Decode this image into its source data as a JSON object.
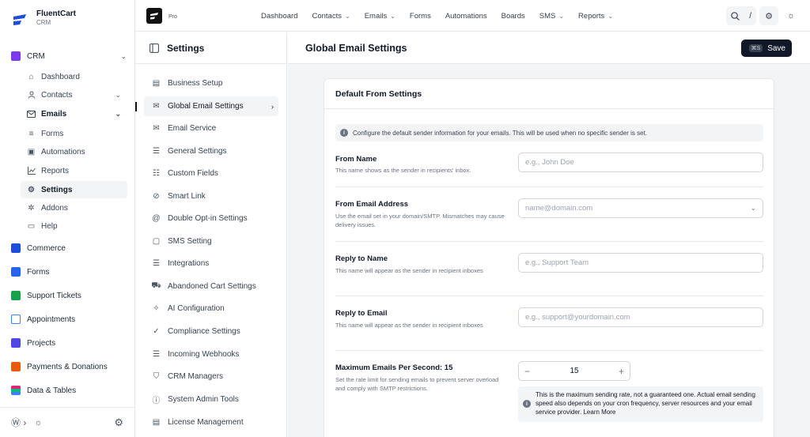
{
  "brand": {
    "name": "FluentCart",
    "subtitle": "CRM"
  },
  "sidebar": {
    "crm_label": "CRM",
    "items": [
      {
        "label": "Dashboard",
        "icon": "home-icon"
      },
      {
        "label": "Contacts",
        "icon": "user-icon"
      },
      {
        "label": "Emails",
        "icon": "mail-icon"
      },
      {
        "label": "Forms",
        "icon": "list-icon"
      },
      {
        "label": "Automations",
        "icon": "automation-icon"
      },
      {
        "label": "Reports",
        "icon": "chart-icon"
      },
      {
        "label": "Settings",
        "icon": "gear-icon"
      },
      {
        "label": "Addons",
        "icon": "addons-icon"
      },
      {
        "label": "Help",
        "icon": "help-icon"
      }
    ],
    "groups": [
      {
        "label": "Commerce",
        "color": "#1d4ed8"
      },
      {
        "label": "Forms",
        "color": "#2563eb"
      },
      {
        "label": "Support Tickets",
        "color": "#16a34a"
      },
      {
        "label": "Appointments",
        "color": "#3b82f6"
      },
      {
        "label": "Projects",
        "color": "#4f46e5"
      },
      {
        "label": "Payments & Donations",
        "color": "#ea580c"
      },
      {
        "label": "Data & Tables",
        "color": "#db2777"
      }
    ]
  },
  "topbar": {
    "pro_label": "Pro",
    "menu": [
      "Dashboard",
      "Contacts",
      "Emails",
      "Forms",
      "Automations",
      "Boards",
      "SMS",
      "Reports"
    ],
    "search_shortcut": "/"
  },
  "settings_nav": {
    "title": "Settings",
    "items": [
      "Business Setup",
      "Global Email Settings",
      "Email Service",
      "General Settings",
      "Custom Fields",
      "Smart Link",
      "Double Opt-in Settings",
      "SMS Setting",
      "Integrations",
      "Abandoned Cart Settings",
      "AI Configuration",
      "Compliance Settings",
      "Incoming Webhooks",
      "CRM Managers",
      "System Admin Tools",
      "License Management"
    ]
  },
  "main": {
    "title": "Global Email Settings",
    "save_shortcut": "⌘S",
    "save_label": "Save",
    "card_title": "Default From Settings",
    "info": "Configure the default sender information for your emails. This will be used when no specific sender is set.",
    "fields": {
      "from_name": {
        "label": "From Name",
        "help": "This name shows as the sender in recipients' inbox.",
        "placeholder": "e.g., John Doe"
      },
      "from_email": {
        "label": "From Email Address",
        "help": "Use the email set in your domain/SMTP. Mismatches may cause delivery issues.",
        "placeholder": "name@domain.com"
      },
      "reply_name": {
        "label": "Reply to Name",
        "help": "This name will appear as the sender in recipient inboxes",
        "placeholder": "e.g., Support Team"
      },
      "reply_email": {
        "label": "Reply to Email",
        "help": "This name will appear as the sender in recipient inboxes",
        "placeholder": "e.g., support@yourdomain.com"
      },
      "max_emails": {
        "label": "Maximum Emails Per Second: 15",
        "help": "Set the rate limit for sending emails to prevent server overload and comply with SMTP restrictions.",
        "value": "15"
      }
    },
    "rate_note": "This is the maximum sending rate, not a guaranteed one. Actual email sending speed also depends on your cron frequency, server resources and your email service provider. Learn More"
  }
}
